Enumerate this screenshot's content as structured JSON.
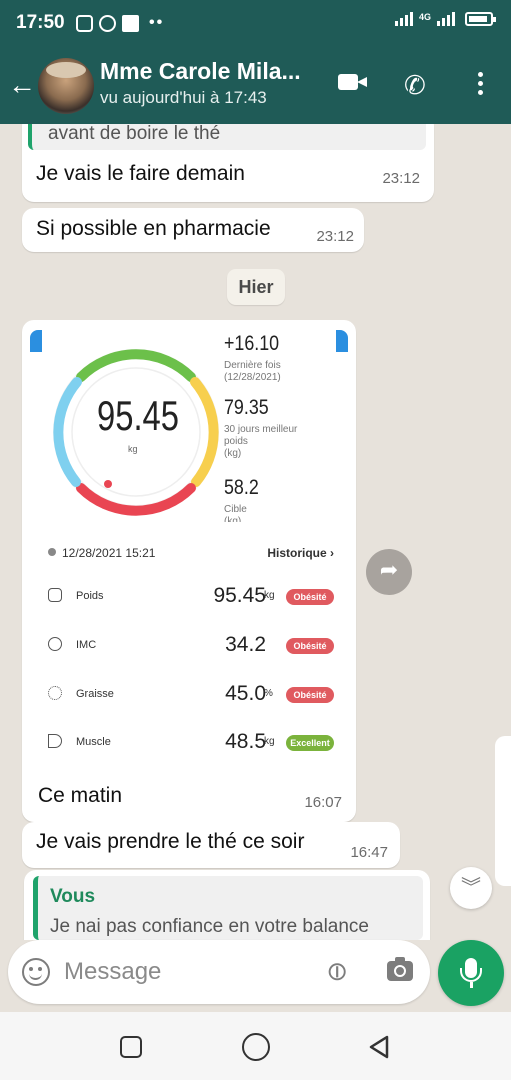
{
  "status_bar": {
    "time": "17:50",
    "network": "4G"
  },
  "header": {
    "contact_name": "Mme Carole Mila...",
    "last_seen": "vu aujourd'hui à 17:43"
  },
  "messages": [
    {
      "quoted": "avant de boire le thé",
      "text": "Je vais le faire demain",
      "time": "23:12"
    },
    {
      "text": "Si possible en pharmacie",
      "time": "23:12"
    }
  ],
  "day_separator": "Hier",
  "image_message": {
    "gauge": {
      "value": "95.45",
      "unit": "kg",
      "level": 0.7
    },
    "stats": [
      {
        "value": "+16.10",
        "label": "Dernière fois",
        "sub": "(12/28/2021)"
      },
      {
        "value": "79.35",
        "label": "30 jours meilleur",
        "sub": "poids",
        "sub2": "(kg)"
      },
      {
        "value": "58.2",
        "label": "Cible",
        "sub": "(kg)"
      }
    ],
    "timestamp": "12/28/2021 15:21",
    "history_label": "Historique",
    "rows": [
      {
        "label": "Poids",
        "value": "95.45",
        "unit": "kg",
        "badge": "Obésité",
        "badge_color": "#e05a5f"
      },
      {
        "label": "IMC",
        "value": "34.2",
        "unit": "",
        "badge": "Obésité",
        "badge_color": "#e05a5f"
      },
      {
        "label": "Graisse",
        "value": "45.0",
        "unit": "%",
        "badge": "Obésité",
        "badge_color": "#e05a5f"
      },
      {
        "label": "Muscle",
        "value": "48.5",
        "unit": "kg",
        "badge": "Excellent",
        "badge_color": "#7bb33c"
      }
    ],
    "caption": "Ce matin",
    "time": "16:07"
  },
  "after_messages": [
    {
      "text": "Je vais prendre le thé ce soir",
      "time": "16:47"
    }
  ],
  "reply_preview": {
    "author": "Vous",
    "text": "Je nai pas confiance en votre balance"
  },
  "input": {
    "placeholder": "Message"
  },
  "colors": {
    "header": "#1f5b57",
    "accent": "#1aa263",
    "obesity_badge": "#e05a5f",
    "excellent_badge": "#7bb33c"
  },
  "icons": [
    "back-arrow-icon",
    "video-call-icon",
    "phone-icon",
    "more-vert-icon",
    "forward-icon",
    "emoji-icon",
    "attach-icon",
    "camera-icon",
    "mic-icon",
    "scroll-down-icon"
  ]
}
